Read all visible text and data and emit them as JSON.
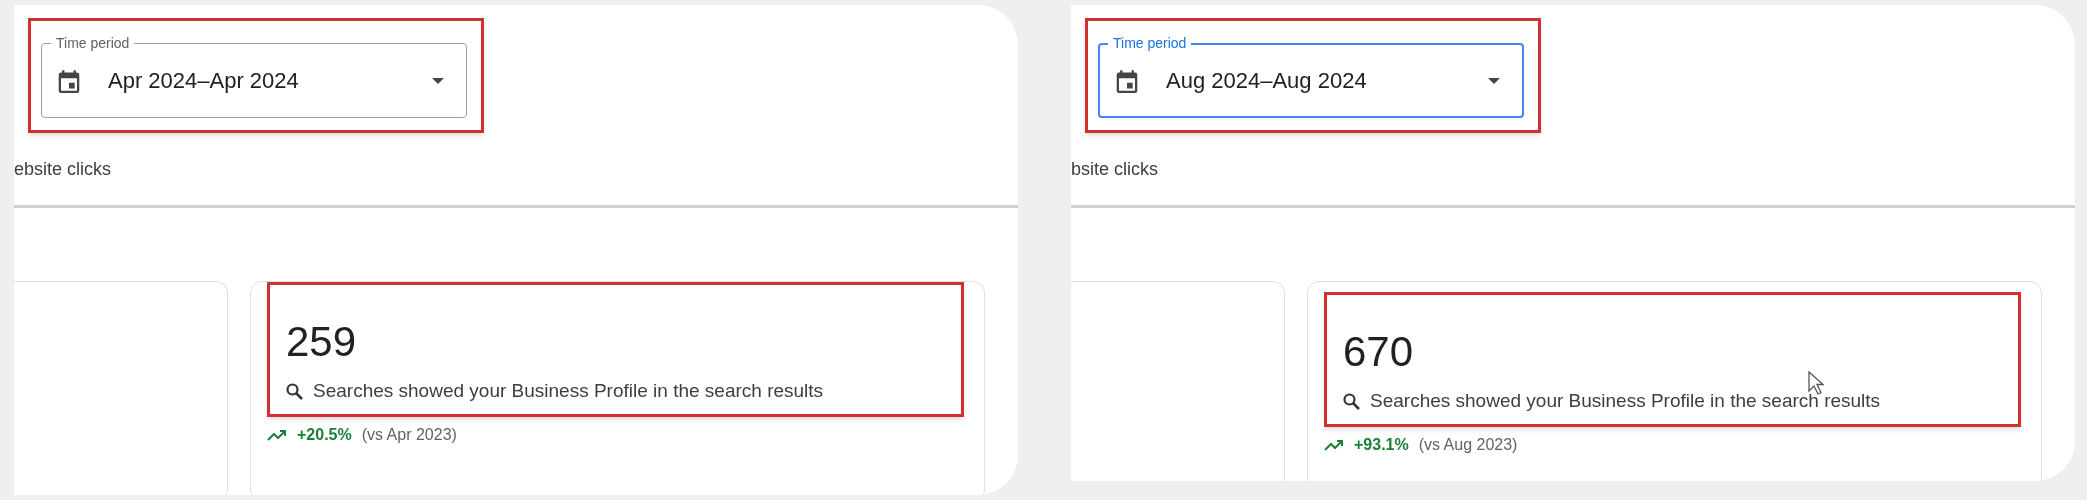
{
  "panels": [
    {
      "time_period": {
        "label": "Time period",
        "value": "Apr 2024–Apr 2024",
        "focused": false
      },
      "tab_label": "ebsite clicks",
      "metric": {
        "value": "259",
        "description": "Searches showed your Business Profile in the search results",
        "change": "+20.5%",
        "comparison": "(vs Apr 2023)"
      },
      "cursor": false
    },
    {
      "time_period": {
        "label": "Time period",
        "value": "Aug 2024–Aug 2024",
        "focused": true
      },
      "tab_label": "bsite clicks",
      "metric": {
        "value": "670",
        "description": "Searches showed your Business Profile in the search results",
        "change": "+93.1%",
        "comparison": "(vs Aug 2023)"
      },
      "cursor": true
    }
  ]
}
